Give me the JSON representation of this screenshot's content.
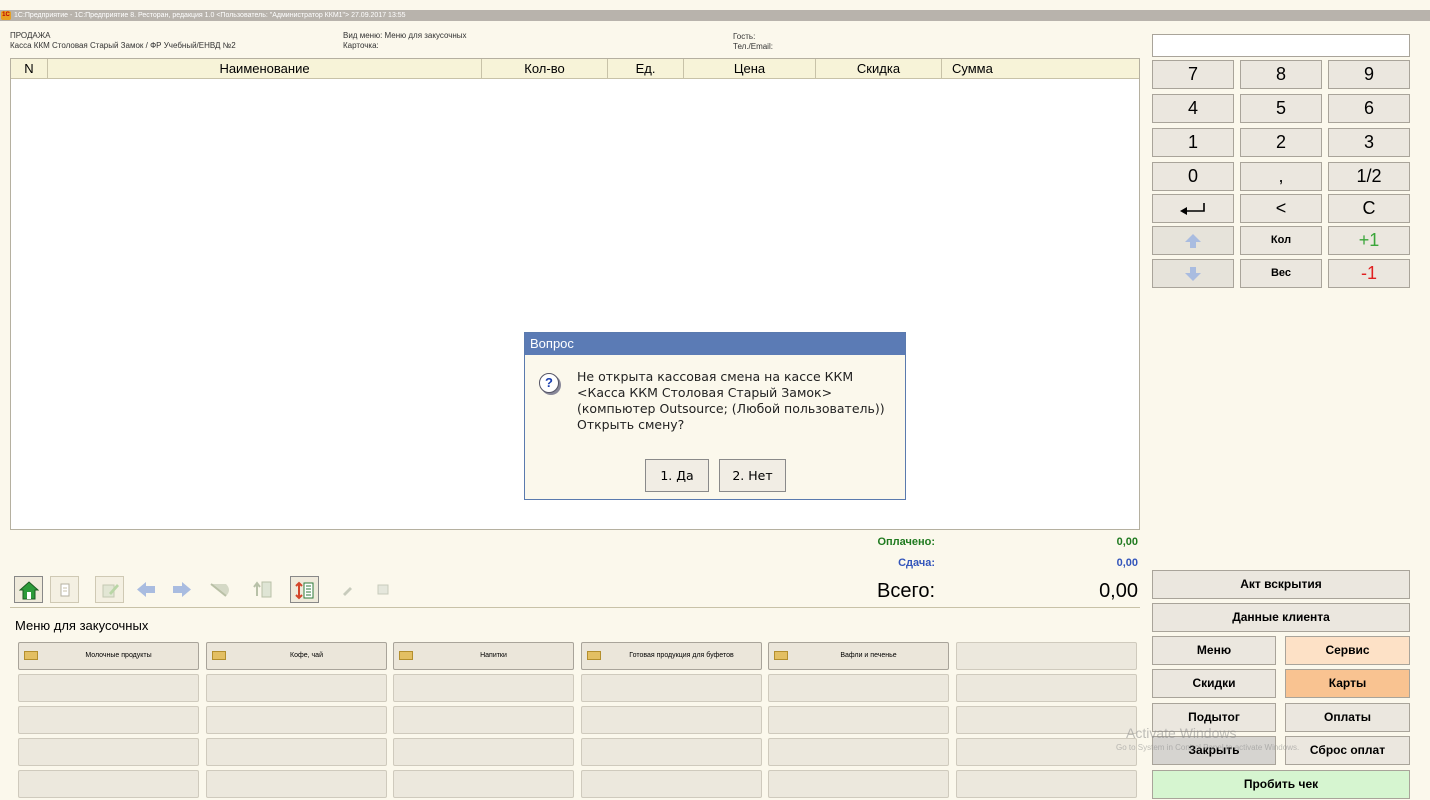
{
  "window": {
    "title": "1С:Предприятие - 1С:Предприятие 8. Ресторан, редакция 1.0 <Пользователь: \"Администратор ККМ1\"> 27.09.2017 13:55",
    "logo_text": "1С"
  },
  "header": {
    "mode": "ПРОДАЖА",
    "register": "Касса ККМ Столовая Старый Замок / ФР Учебный/ЕНВД №2",
    "menu_view": "Вид меню: Меню для закусочных",
    "card": "Карточка:",
    "guest": "Гость:",
    "phone_email": "Тел./Email:"
  },
  "table": {
    "columns": [
      "N",
      "Наименование",
      "Кол-во",
      "Ед.",
      "Цена",
      "Скидка",
      "Сумма"
    ],
    "rows": []
  },
  "dialog": {
    "title": "Вопрос",
    "message": "Не открыта кассовая смена на кассе ККМ <Касса ККМ Столовая Старый Замок> (компьютер Outsource; (Любой пользователь)) Открыть смену?",
    "yes_label": "1. Да",
    "no_label": "2. Нет"
  },
  "totals": {
    "paid_label": "Оплачено:",
    "paid_value": "0,00",
    "change_label": "Сдача:",
    "change_value": "0,00",
    "total_label": "Всего:",
    "total_value": "0,00",
    "paid_color": "#1f7a1f",
    "change_color": "#3355bb"
  },
  "menu": {
    "title": "Меню для закусочных",
    "groups": [
      "Молочные продукты",
      "Кофе, чай",
      "Напитки",
      "Готовая продукция для буфетов",
      "Вафли и печенье"
    ]
  },
  "keypad": {
    "keys": [
      "7",
      "8",
      "9",
      "4",
      "5",
      "6",
      "1",
      "2",
      "3",
      "0",
      ",",
      "1/2",
      "↵",
      "<",
      "C"
    ],
    "qty_label": "Кол",
    "plus_label": "+1",
    "weight_label": "Вес",
    "minus_label": "-1"
  },
  "actions": {
    "opening_act": "Акт вскрытия",
    "client_data": "Данные клиента",
    "menu": "Меню",
    "service": "Сервис",
    "discounts": "Скидки",
    "cards": "Карты",
    "subtotal": "Подытог",
    "payments": "Оплаты",
    "close": "Закрыть",
    "reset_payments": "Сброс оплат",
    "print_receipt": "Пробить чек"
  },
  "watermark": {
    "line1": "Activate Windows",
    "line2": "Go to System in Control Panel to activate Windows."
  }
}
